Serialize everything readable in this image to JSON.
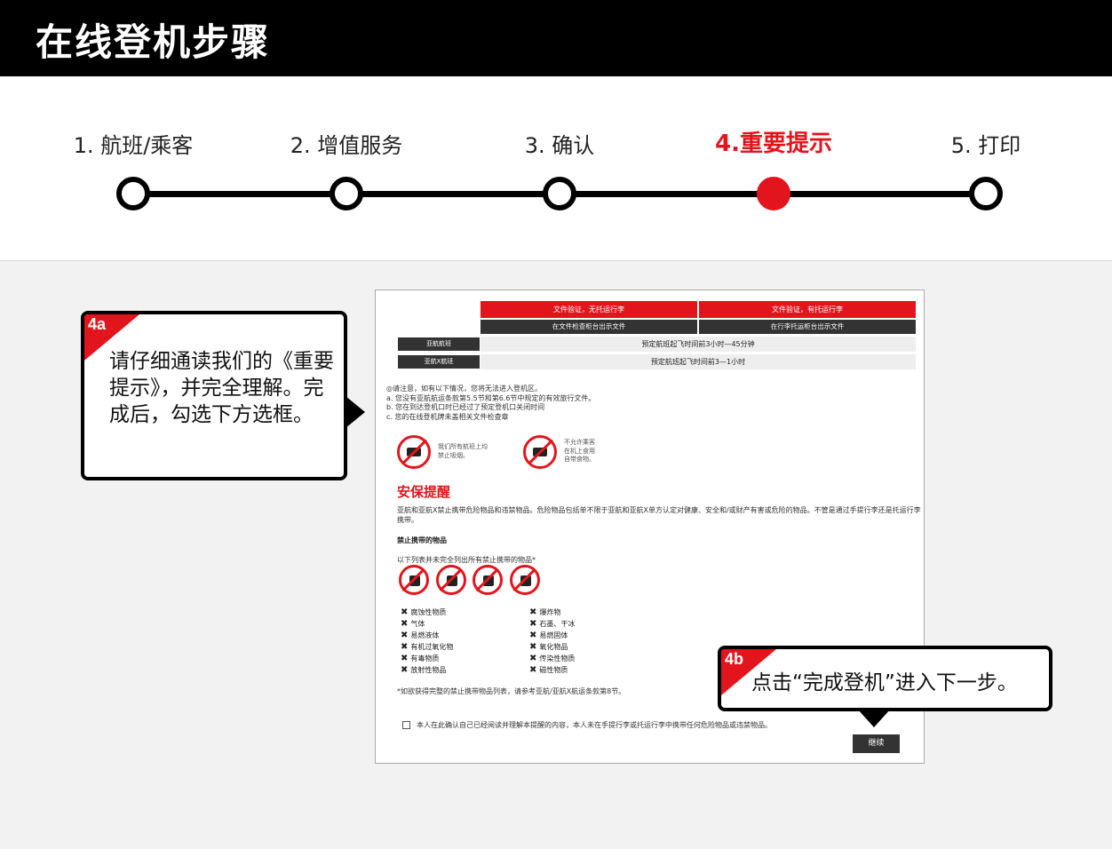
{
  "header": {
    "title": "在线登机步骤"
  },
  "steps": [
    {
      "label": "1. 航班/乘客",
      "active": false
    },
    {
      "label": "2. 增值服务",
      "active": false
    },
    {
      "label": "3. 确认",
      "active": false
    },
    {
      "label": "4.重要提示",
      "active": true
    },
    {
      "label": "5. 打印",
      "active": false
    }
  ],
  "callout_a": {
    "tag": "4a",
    "text": "请仔细通读我们的《重要提示》，并完全理解。完成后，勾选下方选框。"
  },
  "callout_b": {
    "tag": "4b",
    "text": "点击“完成登机”进入下一步。"
  },
  "doc": {
    "col_headers": [
      "文件验证，无托运行李",
      "文件验证，有托运行李"
    ],
    "col_subheaders": [
      "在文件检查柜台出示文件",
      "在行李托运柜台出示文件"
    ],
    "rows": [
      {
        "label": "亚航航班",
        "value": "预定航班起飞时间前3小时—45分钟"
      },
      {
        "label": "亚航X航班",
        "value": "预定航班起飞时间前3—1小时"
      }
    ],
    "note_intro": "◎请注意，如有以下情况，您将无法进入登机区。",
    "note_items": [
      "a.  您没有亚航航运条款第5.5节和第6.6节中规定的有效旅行文件。",
      "b.  您在到达登机口时已经过了预定登机口关闭时间",
      "c.  您的在线登机牌未盖相关文件检查章"
    ],
    "sign1_text": [
      "我们所有航班上均",
      "禁止吸烟。"
    ],
    "sign2_text": [
      "不允许乘客",
      "在机上食用",
      "自带食物。"
    ],
    "security_title": "安保提醒",
    "security_body": "亚航和亚航X禁止携带危险物品和违禁物品。危险物品包括单不限于亚航和亚航X单方认定对健康、安全和/或财产有害或危险的物品。不管是通过手提行李还是托运行李携带。",
    "prohibited_title": "禁止携带的物品",
    "list_note": "以下列表并未完全列出所有禁止携带的物品*",
    "items_left": [
      "腐蚀性物质",
      "气体",
      "易燃液体",
      "有机过氧化物",
      "有毒物质",
      "放射性物品"
    ],
    "items_right": [
      "爆炸物",
      "石墨、干冰",
      "易燃固体",
      "氧化物品",
      "传染性物质",
      "磁性物质"
    ],
    "footnote": "*如欲获得完整的禁止携带物品列表，请参考亚航/亚航X航运条款第8节。",
    "confirm_text": "本人在此确认自己已经阅读并理解本提醒的内容，本人未在手提行李或托运行李中携带任何危险物品或违禁物品。",
    "continue_label": "继续"
  }
}
